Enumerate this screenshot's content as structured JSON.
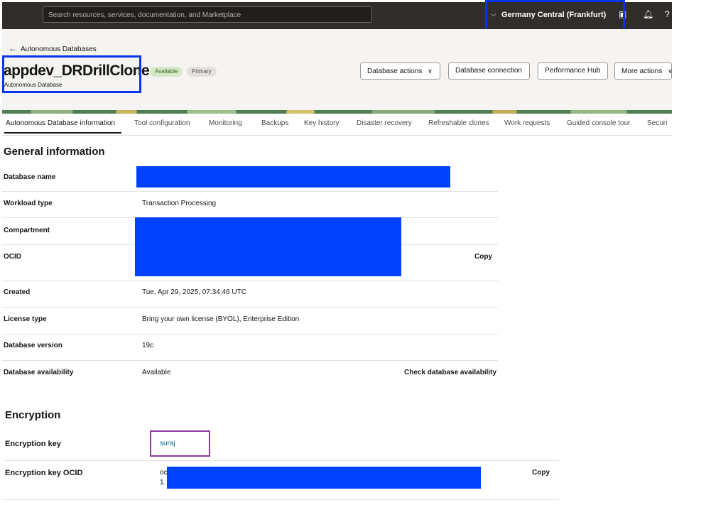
{
  "topbar": {
    "search_placeholder": "Search resources, services, documentation, and Marketplace",
    "region": "Germany Central (Frankfurt)",
    "icons": [
      "chevron-down-icon",
      "cloud-shell-icon",
      "bell-icon",
      "help-icon"
    ]
  },
  "header": {
    "back_link": "Autonomous Databases",
    "title": "appdev_DRDrillClone",
    "subtitle": "Autonomous Database",
    "badges": {
      "available": "Available",
      "primary": "Primary"
    },
    "buttons": {
      "db_actions": "Database actions",
      "db_connection": "Database connection",
      "perf_hub": "Performance Hub",
      "more_actions": "More actions"
    }
  },
  "tabs": [
    "Autonomous Database information",
    "Tool configuration",
    "Monitoring",
    "Backups",
    "Key history",
    "Disaster recovery",
    "Refreshable clones",
    "Work requests",
    "Guided console tour",
    "Securi"
  ],
  "general": {
    "title": "General information",
    "rows": {
      "db_name": {
        "label": "Database name"
      },
      "workload": {
        "label": "Workload type",
        "value": "Transaction Processing"
      },
      "compartment": {
        "label": "Compartment"
      },
      "ocid": {
        "label": "OCID",
        "action": "Copy"
      },
      "created": {
        "label": "Created",
        "value": "Tue, Apr 29, 2025, 07:34:46 UTC"
      },
      "license": {
        "label": "License type",
        "value": "Bring your own license (BYOL), Enterprise Edition"
      },
      "version": {
        "label": "Database version",
        "value": "19c"
      },
      "availability": {
        "label": "Database availability",
        "value": "Available",
        "action": "Check database availability"
      }
    }
  },
  "encryption": {
    "title": "Encryption",
    "key_label": "Encryption key",
    "key_value": "suraj",
    "key_ocid_label": "Encryption key OCID",
    "key_ocid_prefix_1": "oc",
    "key_ocid_prefix_2": "1.",
    "copy": "Copy"
  },
  "colors": {
    "topbar": "#312d2a",
    "redaction": "#0042ff",
    "highlight_blue": "#0a35e6",
    "highlight_purple": "#8e3a9f",
    "link": "#00688c"
  }
}
